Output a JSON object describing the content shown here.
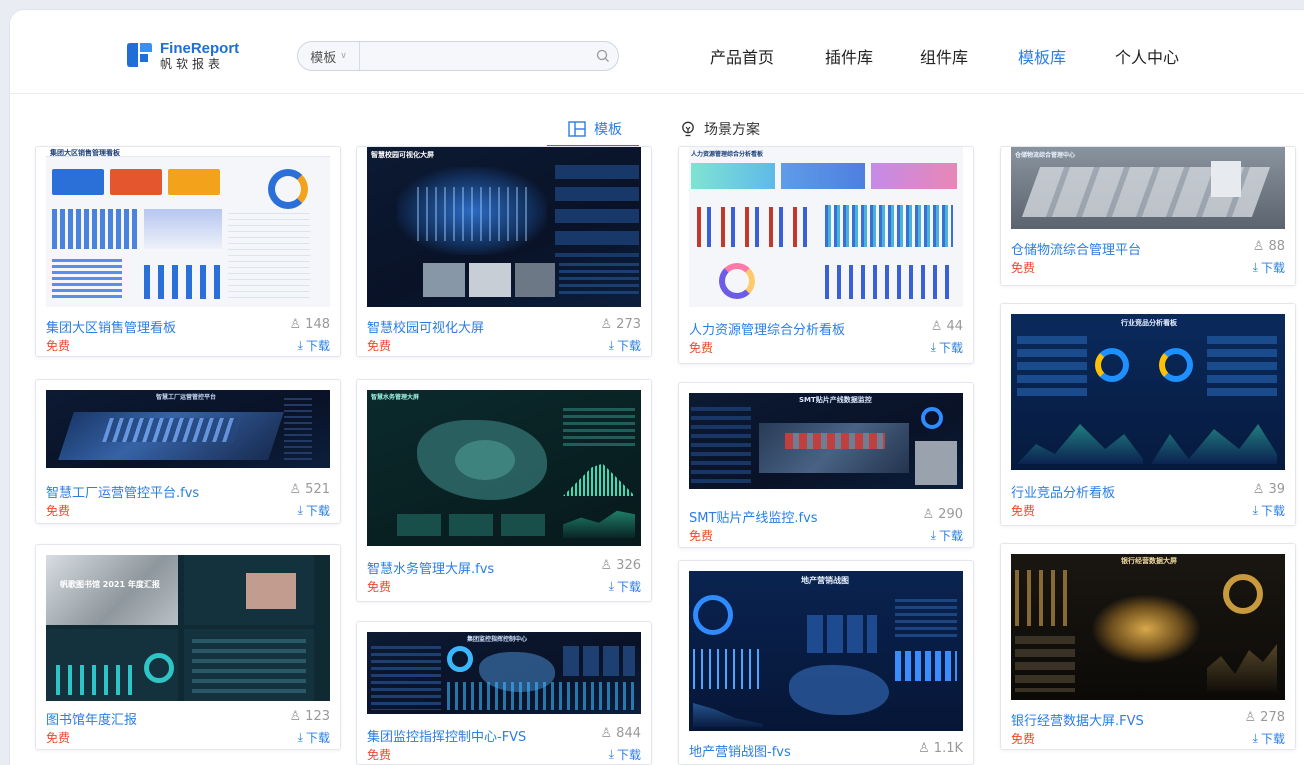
{
  "header": {
    "logo_en": "FineReport",
    "logo_cn": "帆软报表",
    "search_type": "模板",
    "search_placeholder": "",
    "nav": [
      {
        "label": "产品首页",
        "active": false
      },
      {
        "label": "插件库",
        "active": false
      },
      {
        "label": "组件库",
        "active": false
      },
      {
        "label": "模板库",
        "active": true
      },
      {
        "label": "个人中心",
        "active": false
      }
    ]
  },
  "tabs": [
    {
      "label": "模板",
      "active": true
    },
    {
      "label": "场景方案",
      "active": false
    }
  ],
  "download_label": "下载",
  "cards": [
    {
      "title": "集团大区销售管理看板",
      "price": "免费",
      "views": "148",
      "thumb_title": "集团大区销售管理看板",
      "theme": "light"
    },
    {
      "title": "智慧校园可视化大屏",
      "price": "免费",
      "views": "273",
      "thumb_title": "智慧校园可视化大屏",
      "theme": "dark"
    },
    {
      "title": "人力资源管理综合分析看板",
      "price": "免费",
      "views": "44",
      "thumb_title": "人力资源管理综合分析看板",
      "theme": "light"
    },
    {
      "title": "仓储物流综合管理平台",
      "price": "免费",
      "views": "88",
      "thumb_title": "仓储物流综合管理中心",
      "theme": "gray"
    },
    {
      "title": "智慧工厂运营管控平台.fvs",
      "price": "免费",
      "views": "521",
      "thumb_title": "智慧工厂运营管控平台",
      "theme": "dark"
    },
    {
      "title": "智慧水务管理大屏.fvs",
      "price": "免费",
      "views": "326",
      "thumb_title": "智慧水务管理大屏",
      "theme": "dark"
    },
    {
      "title": "SMT贴片产线监控.fvs",
      "price": "免费",
      "views": "290",
      "thumb_title": "SMT贴片产线数据监控",
      "theme": "dark"
    },
    {
      "title": "行业竞品分析看板",
      "price": "免费",
      "views": "39",
      "thumb_title": "行业竞品分析看板",
      "theme": "dark"
    },
    {
      "title": "图书馆年度汇报",
      "price": "免费",
      "views": "123",
      "thumb_title": "帆歌图书馆 2021 年度汇报",
      "theme": "dark"
    },
    {
      "title": "集团监控指挥控制中心-FVS",
      "price": "免费",
      "views": "844",
      "thumb_title": "集团监控指挥控制中心",
      "theme": "dark"
    },
    {
      "title": "地产营销战图-fvs",
      "price": "",
      "views": "1.1K",
      "thumb_title": "地产营销战图",
      "theme": "dark"
    },
    {
      "title": "银行经营数据大屏.FVS",
      "price": "免费",
      "views": "278",
      "thumb_title": "银行经营数据大屏",
      "theme": "dark"
    }
  ]
}
